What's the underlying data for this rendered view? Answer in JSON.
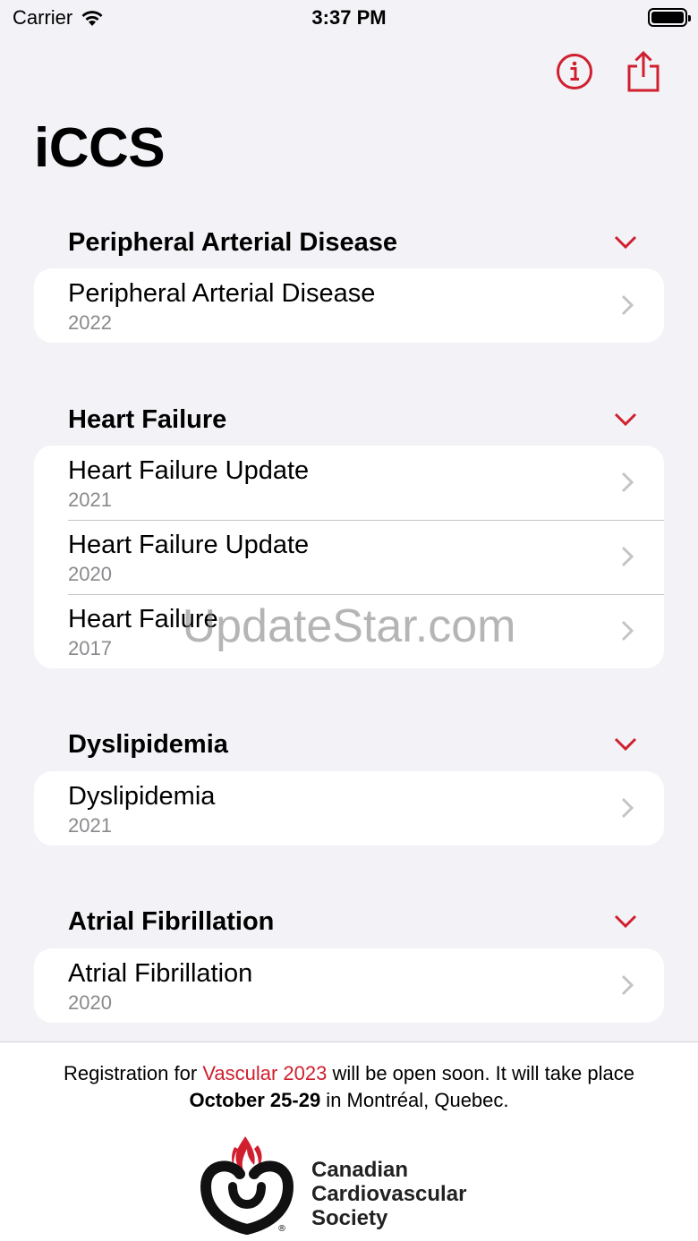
{
  "status_bar": {
    "carrier": "Carrier",
    "time": "3:37 PM"
  },
  "nav": {
    "info_icon": "info-circle-icon",
    "share_icon": "share-icon"
  },
  "page_title": "iCCS",
  "accent_color": "#d0202f",
  "sections": [
    {
      "title": "Peripheral Arterial Disease",
      "items": [
        {
          "title": "Peripheral Arterial Disease",
          "year": "2022"
        }
      ]
    },
    {
      "title": "Heart Failure",
      "items": [
        {
          "title": "Heart Failure Update",
          "year": "2021"
        },
        {
          "title": "Heart Failure Update",
          "year": "2020"
        },
        {
          "title": "Heart Failure",
          "year": "2017"
        }
      ]
    },
    {
      "title": "Dyslipidemia",
      "items": [
        {
          "title": "Dyslipidemia",
          "year": "2021"
        }
      ]
    },
    {
      "title": "Atrial Fibrillation",
      "items": [
        {
          "title": "Atrial Fibrillation",
          "year": "2020"
        }
      ]
    }
  ],
  "watermark": "UpdateStar.com",
  "footer": {
    "part1": "Registration for ",
    "link": "Vascular 2023",
    "part2": " will be open soon. It will take place",
    "dates": "October 25-29",
    "part3": " in Montréal, Quebec.",
    "logo_line1": "Canadian",
    "logo_line2": "Cardiovascular",
    "logo_line3": "Society"
  }
}
